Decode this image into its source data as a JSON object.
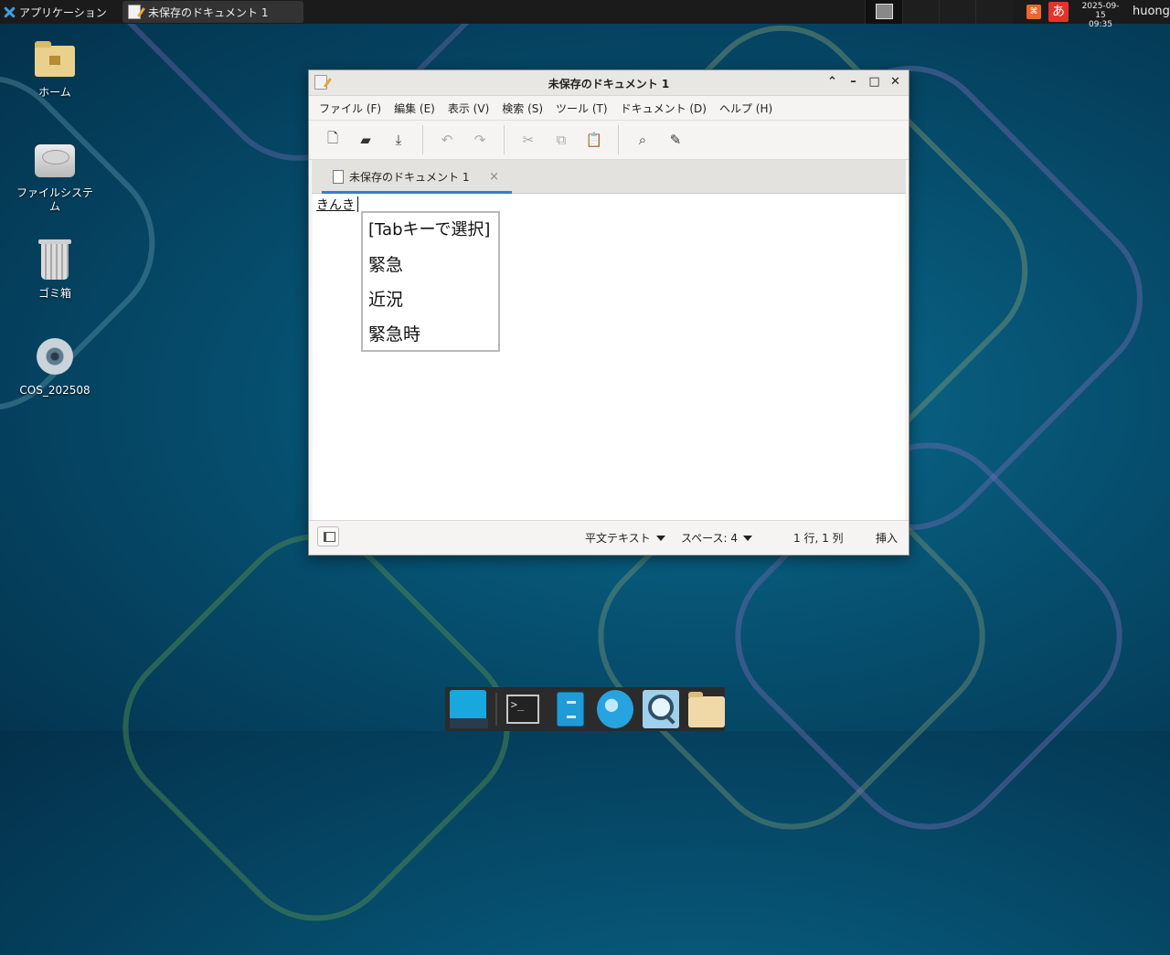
{
  "top_panel": {
    "apps_label": "アプリケーション",
    "task_title": "未保存のドキュメント 1",
    "clock_date": "2025-09-15",
    "clock_time": "09:35",
    "ime_label": "あ",
    "username": "huong"
  },
  "desktop": {
    "icons": [
      {
        "label": "ホーム",
        "icon": "home-folder-icon"
      },
      {
        "label": "ファイルシステム",
        "icon": "drive-icon"
      },
      {
        "label": "ゴミ箱",
        "icon": "trash-icon"
      },
      {
        "label": "COS_202508",
        "icon": "disc-icon"
      }
    ]
  },
  "window": {
    "title": "未保存のドキュメント 1",
    "menu": [
      "ファイル (F)",
      "編集 (E)",
      "表示 (V)",
      "検索 (S)",
      "ツール (T)",
      "ドキュメント (D)",
      "ヘルプ (H)"
    ],
    "toolbar_icons": [
      "new-document-icon",
      "open-folder-icon",
      "save-icon",
      "undo-icon",
      "redo-icon",
      "cut-icon",
      "copy-icon",
      "paste-icon",
      "search-icon",
      "replace-icon"
    ],
    "tab_label": "未保存のドキュメント 1",
    "tab_close": "×",
    "editor_text": "きんき",
    "ime_candidates": [
      "[Tabキーで選択]",
      "緊急",
      "近況",
      "緊急時"
    ],
    "status": {
      "syntax": "平文テキスト",
      "spaces": "スペース: 4",
      "position": "1 行, 1 列",
      "mode": "挿入"
    }
  },
  "dock": {
    "items": [
      "show-desktop-icon",
      "terminal-icon",
      "file-manager-icon",
      "web-browser-icon",
      "app-finder-icon",
      "home-folder-icon"
    ]
  }
}
